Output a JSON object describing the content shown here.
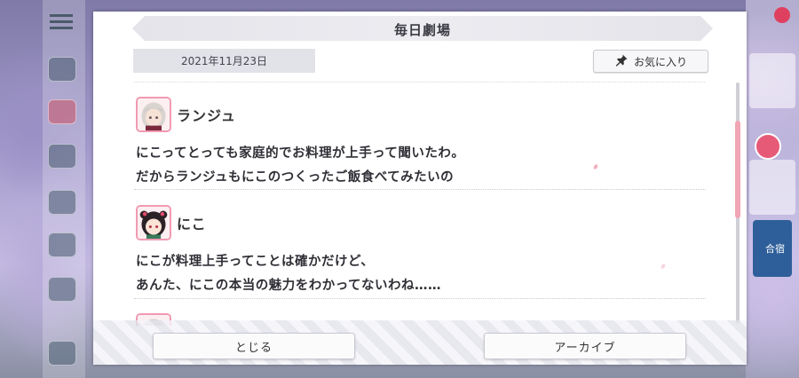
{
  "dialog": {
    "title": "毎日劇場",
    "date": "2021年11月23日",
    "favorite_label": "お気に入り",
    "close_label": "とじる",
    "archive_label": "アーカイブ"
  },
  "entries": [
    {
      "speaker": "ランジュ",
      "lines": [
        "にこってとっても家庭的でお料理が上手って聞いたわ。",
        "だからランジュもにこのつくったご飯食べてみたいの"
      ]
    },
    {
      "speaker": "にこ",
      "lines": [
        "にこが料理上手ってことは確かだけど、",
        "あんた、にこの本当の魅力をわかってないわね……"
      ]
    }
  ],
  "background": {
    "right_rail_label": "合宿"
  },
  "colors": {
    "accent_pink": "#f29ab2",
    "scroll_thumb": "#f0a6b4",
    "text": "#2f2f36"
  },
  "icons": {
    "favorite": "pin-icon",
    "menu": "menu-icon"
  }
}
